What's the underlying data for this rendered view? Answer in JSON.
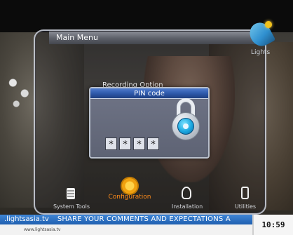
{
  "main_menu": {
    "title": "Main Menu",
    "background_item": "Recording Option"
  },
  "brand": {
    "logo_text": "Lights"
  },
  "pin_dialog": {
    "title": "PIN code",
    "digits": [
      "*",
      "*",
      "*",
      "*"
    ],
    "icon": "padlock-icon"
  },
  "bottom_menu": {
    "items": [
      {
        "label": "System Tools",
        "icon": "system-tools-icon",
        "active": false
      },
      {
        "label": "Configuration",
        "icon": "configuration-icon",
        "active": true
      },
      {
        "label": "Installation",
        "icon": "installation-icon",
        "active": false
      },
      {
        "label": "Utilities",
        "icon": "utilities-icon",
        "active": false
      }
    ]
  },
  "ticker": {
    "site": ".lightsasia.tv",
    "message": "SHARE YOUR COMMENTS AND EXPECTATIONS A",
    "footer_url": "www.lightsasia.tv",
    "time": "10:59"
  },
  "colors": {
    "accent_active": "#ff8c1a",
    "dialog_header": "#2c57a8",
    "ticker_blue": "#1f5fb0"
  }
}
